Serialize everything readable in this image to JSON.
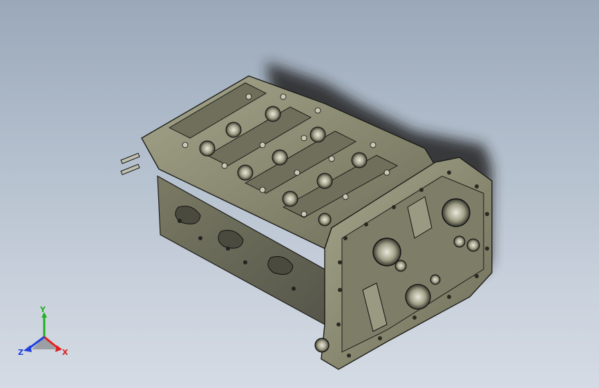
{
  "viewport": {
    "background_top": "#9aa8b9",
    "background_bottom": "#d4dbe4",
    "model_color": "#8a8a72",
    "model_edge_color": "#1c1c18"
  },
  "model": {
    "icon": "cylinder-head-model"
  },
  "triad": {
    "x_label": "X",
    "y_label": "Y",
    "z_label": "Z",
    "x_color": "#e02020",
    "y_color": "#20b020",
    "z_color": "#2040e0"
  }
}
